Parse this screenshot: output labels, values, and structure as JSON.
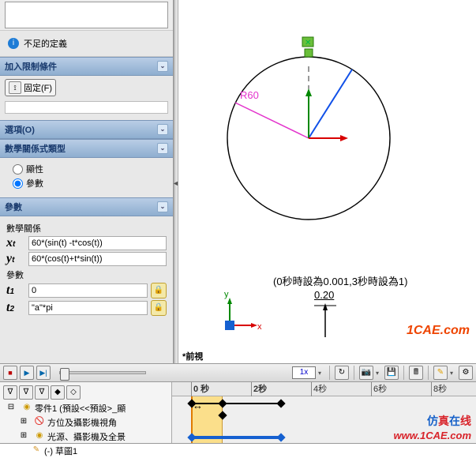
{
  "info_text": "不足的定義",
  "panels": {
    "constraint": {
      "title": "加入限制條件",
      "fixed": "固定(F)"
    },
    "options": {
      "title": "選項(O)"
    },
    "equation_type": {
      "title": "數學關係式類型",
      "r1": "顯性",
      "r2": "參數"
    },
    "params": {
      "title": "參數",
      "rel_label": "數學關係",
      "xt": "60*(sin(t) -t*cos(t))",
      "yt": "60*(cos(t)+t*sin(t))",
      "param_label": "參數",
      "t1": "0",
      "t2": "\"a\"*pi"
    }
  },
  "canvas": {
    "radius_label": "R60",
    "annotation": "(0秒時設為0.001,3秒時設為1)",
    "dim": "0.20",
    "view_label": "*前視",
    "watermark": "1CAE.com",
    "triad_x": "x",
    "triad_y": "y"
  },
  "playbar": {
    "speed": "1x"
  },
  "timeline": {
    "ticks": [
      "0 秒",
      "2秒",
      "4秒",
      "6秒",
      "8秒"
    ],
    "tree": {
      "root": "零件1 (預設<<預設>_顯",
      "n1": "方位及攝影機視角",
      "n2": "光源、攝影機及全景",
      "n3": "(-) 草圖1"
    }
  },
  "brand": {
    "c1": "仿",
    "c2": "真",
    "c3": "在",
    "c4": "线",
    "url": "www.1CAE.com"
  }
}
